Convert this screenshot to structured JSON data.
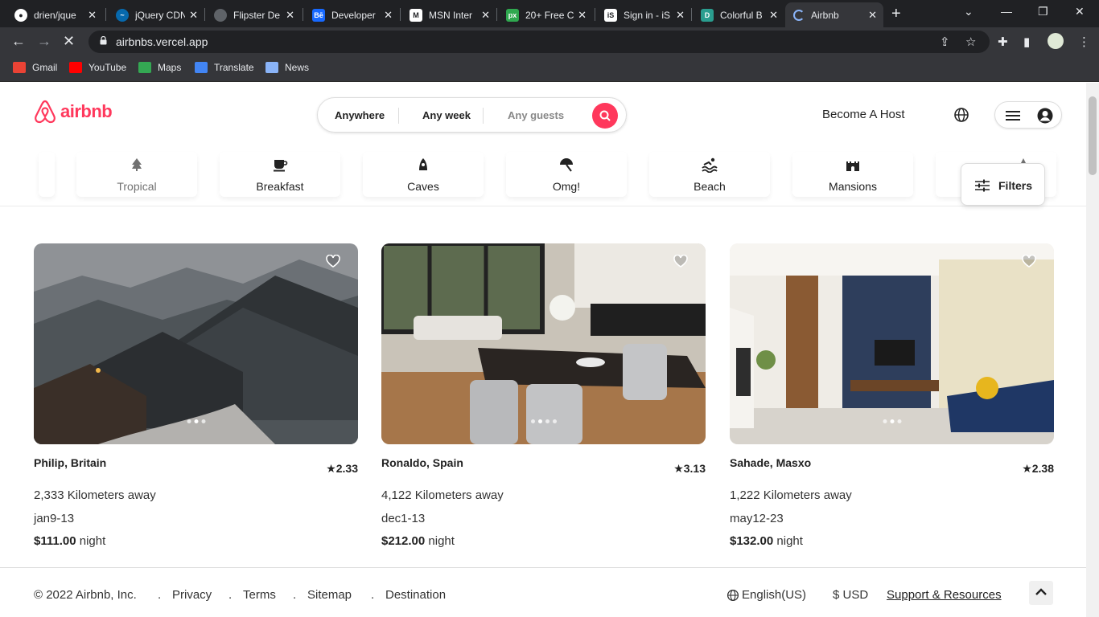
{
  "browser": {
    "tabs": [
      {
        "title": "drien/jque",
        "icon": "github-icon",
        "color": "#24292e"
      },
      {
        "title": "jQuery CDN",
        "icon": "jquery-icon",
        "color": "#0769ad"
      },
      {
        "title": "Flipster De",
        "icon": "globe-icon",
        "color": "#5f6368"
      },
      {
        "title": "Developer",
        "icon": "behance-icon",
        "color": "#1769ff"
      },
      {
        "title": "MSN Inter",
        "icon": "msn-icon",
        "color": "#555555"
      },
      {
        "title": "20+ Free C",
        "icon": "px-icon",
        "color": "#2fa84f"
      },
      {
        "title": "Sign in - iS",
        "icon": "is-icon",
        "color": "#202124"
      },
      {
        "title": "Colorful B",
        "icon": "d-icon",
        "color": "#2a9d8f"
      },
      {
        "title": "Airbnb",
        "icon": "airbnb-loading-icon",
        "color": "#35363a"
      }
    ],
    "url": "airbnbs.vercel.app",
    "bookmarks": [
      {
        "label": "Gmail",
        "color": "#ea4335"
      },
      {
        "label": "YouTube",
        "color": "#ff0000"
      },
      {
        "label": "Maps",
        "color": "#34a853"
      },
      {
        "label": "Translate",
        "color": "#4285f4"
      },
      {
        "label": "News",
        "color": "#4285f4"
      }
    ]
  },
  "header": {
    "logo_text": "airbnb",
    "brand_color": "#ff385c",
    "search": {
      "where": "Anywhere",
      "when": "Any week",
      "guests": "Any guests"
    },
    "become_host": "Become A Host"
  },
  "categories": [
    {
      "label": "Tropical",
      "icon": "palm-tree-icon"
    },
    {
      "label": "Breakfast",
      "icon": "coffee-cup-icon"
    },
    {
      "label": "Caves",
      "icon": "cave-icon"
    },
    {
      "label": "Omg!",
      "icon": "umbrella-icon"
    },
    {
      "label": "Beach",
      "icon": "swimmer-icon"
    },
    {
      "label": "Mansions",
      "icon": "castle-icon"
    }
  ],
  "filters_label": "Filters",
  "listings": [
    {
      "place": "Philip, Britain",
      "rating": "★2.33",
      "distance": "2,333 Kilometers away",
      "dates": "jan9-13",
      "price": "$111.00",
      "unit": "night"
    },
    {
      "place": "Ronaldo, Spain",
      "rating": "★3.13",
      "distance": "4,122 Kilometers away",
      "dates": "dec1-13",
      "price": "$212.00",
      "unit": "night"
    },
    {
      "place": "Sahade, Masxo",
      "rating": "★2.38",
      "distance": "1,222 Kilometers away",
      "dates": "may12-23",
      "price": "$132.00",
      "unit": "night"
    }
  ],
  "footer": {
    "copyright": "© 2022 Airbnb, Inc.",
    "links": [
      "Privacy",
      "Terms",
      "Sitemap",
      "Destination"
    ],
    "language": "English(US)",
    "currency": "USD",
    "currency_symbol": "$",
    "support": "Support & Resources"
  }
}
